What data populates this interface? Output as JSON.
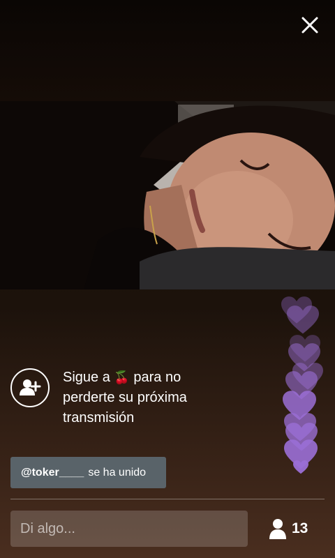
{
  "header": {
    "close_icon": "close-icon"
  },
  "video": {
    "description_icon": "live-video"
  },
  "follow_prompt": {
    "icon": "add-user-icon",
    "before": "Sigue a ",
    "emoji": "🍒",
    "after": " para no perderte su próxima transmisión"
  },
  "joined_notice": {
    "username": "@toker____",
    "message": "se ha unido"
  },
  "comment_box": {
    "placeholder": "Di algo..."
  },
  "viewers": {
    "icon": "person-icon",
    "count": "13"
  },
  "reactions": {
    "heart_color": "#9b6fd6",
    "icon": "heart-icon"
  }
}
